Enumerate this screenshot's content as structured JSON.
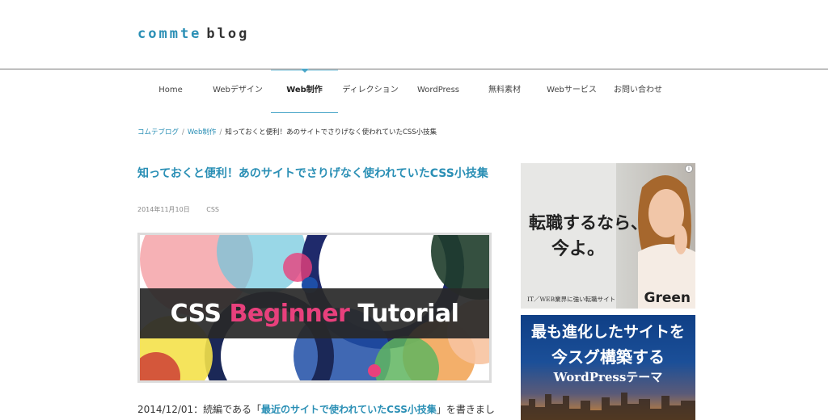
{
  "logo": {
    "part1": "commte",
    "part2": "blog"
  },
  "nav": {
    "items": [
      {
        "label": "Home"
      },
      {
        "label": "Webデザイン"
      },
      {
        "label": "Web制作"
      },
      {
        "label": "ディレクション"
      },
      {
        "label": "WordPress"
      },
      {
        "label": "無料素材"
      },
      {
        "label": "Webサービス"
      },
      {
        "label": "お問い合わせ"
      }
    ],
    "active": "Web制作"
  },
  "breadcrumb": {
    "items": [
      "コムテブログ",
      "Web制作",
      "知っておくと便利！あのサイトでさりげなく使われていたCSS小技集"
    ],
    "separator": "/"
  },
  "article": {
    "title": "知っておくと便利！あのサイトでさりげなく使われていたCSS小技集",
    "date": "2014年11月10日",
    "category": "CSS",
    "hero": {
      "word1": "CSS",
      "word2": "Beginner",
      "word3": "Tutorial"
    },
    "body": {
      "prefix": "2014/12/01：続編である「",
      "link": "最近のサイトで使われていたCSS小技集",
      "suffix": "」を書きまし"
    }
  },
  "ads": {
    "ad1": {
      "info": "i",
      "headline1": "転職するなら、",
      "headline2": "今よ。",
      "footer": "IT／WEB業界に強い転職サイト",
      "brand": "Green"
    },
    "ad2": {
      "line1": "最も進化したサイトを",
      "line2": "今スグ構築する",
      "line3": "WordPressテーマ"
    }
  },
  "colors": {
    "accent": "#2a8fb5",
    "pink": "#e8407c",
    "nav_active_line": "#4aa6c8"
  }
}
